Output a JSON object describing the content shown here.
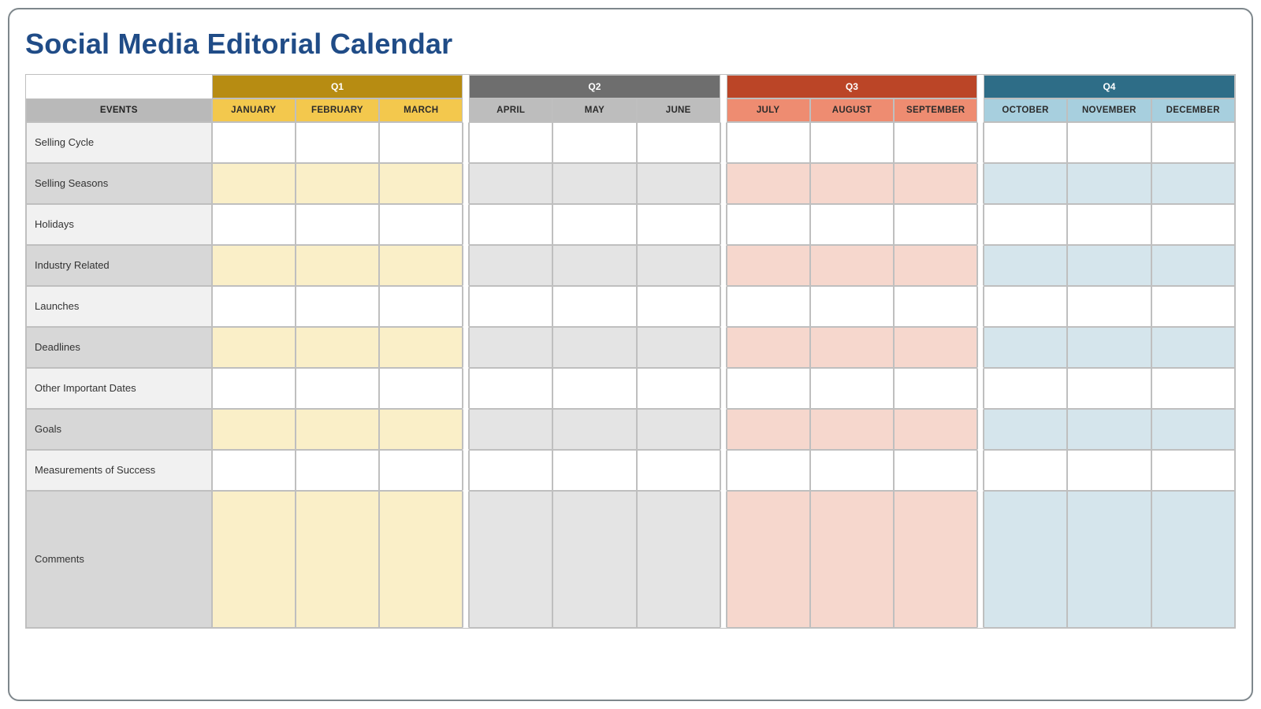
{
  "title": "Social Media Editorial Calendar",
  "events_header": "EVENTS",
  "quarters": {
    "q1": {
      "label": "Q1",
      "months": [
        "JANUARY",
        "FEBRUARY",
        "MARCH"
      ]
    },
    "q2": {
      "label": "Q2",
      "months": [
        "APRIL",
        "MAY",
        "JUNE"
      ]
    },
    "q3": {
      "label": "Q3",
      "months": [
        "JULY",
        "AUGUST",
        "SEPTEMBER"
      ]
    },
    "q4": {
      "label": "Q4",
      "months": [
        "OCTOBER",
        "NOVEMBER",
        "DECEMBER"
      ]
    }
  },
  "rows": [
    {
      "label": "Selling Cycle",
      "shaded": false
    },
    {
      "label": "Selling Seasons",
      "shaded": true
    },
    {
      "label": "Holidays",
      "shaded": false
    },
    {
      "label": "Industry Related",
      "shaded": true
    },
    {
      "label": "Launches",
      "shaded": false
    },
    {
      "label": "Deadlines",
      "shaded": true
    },
    {
      "label": "Other Important Dates",
      "shaded": false
    },
    {
      "label": "Goals",
      "shaded": true
    },
    {
      "label": "Measurements of Success",
      "shaded": false
    },
    {
      "label": "Comments",
      "shaded": true,
      "tall": true
    }
  ]
}
